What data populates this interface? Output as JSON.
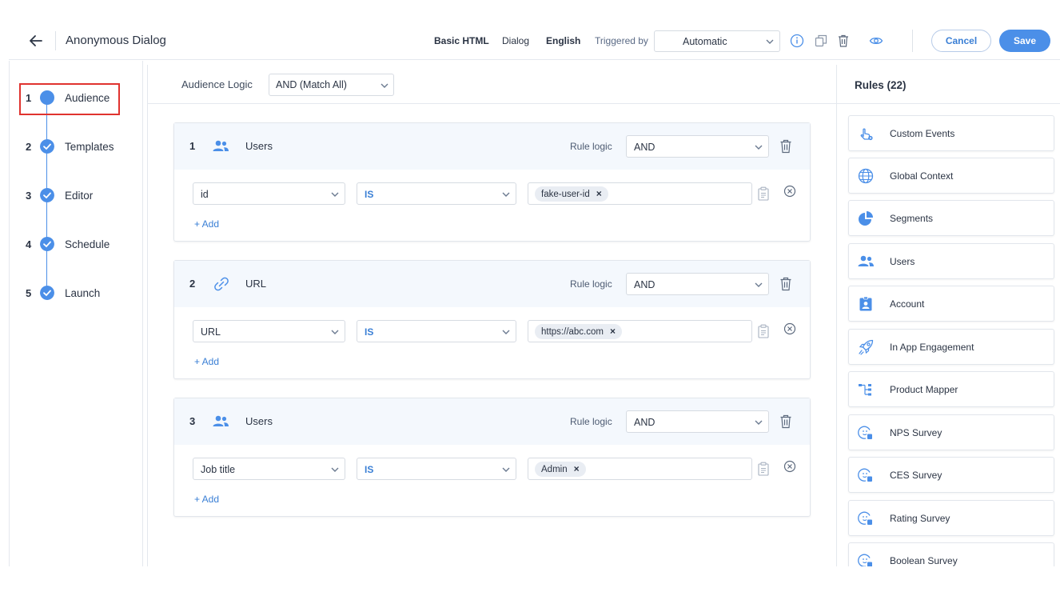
{
  "header": {
    "title": "Anonymous Dialog",
    "template_type": "Basic HTML",
    "dialog_type": "Dialog",
    "language": "English",
    "triggered_by_label": "Triggered by",
    "triggered_by_value": "Automatic",
    "cancel_label": "Cancel",
    "save_label": "Save"
  },
  "stepper": {
    "steps": [
      {
        "num": "1",
        "label": "Audience",
        "state": "active"
      },
      {
        "num": "2",
        "label": "Templates",
        "state": "done"
      },
      {
        "num": "3",
        "label": "Editor",
        "state": "done"
      },
      {
        "num": "4",
        "label": "Schedule",
        "state": "done"
      },
      {
        "num": "5",
        "label": "Launch",
        "state": "done"
      }
    ]
  },
  "main": {
    "audience_logic_label": "Audience Logic",
    "audience_logic_value": "AND (Match All)",
    "rules": [
      {
        "num": "1",
        "type": "Users",
        "icon": "users-icon",
        "rule_logic_label": "Rule logic",
        "rule_logic_value": "AND",
        "attribute": "id",
        "operator": "IS",
        "value_chip": "fake-user-id",
        "add_label": "+ Add"
      },
      {
        "num": "2",
        "type": "URL",
        "icon": "link-icon",
        "rule_logic_label": "Rule logic",
        "rule_logic_value": "AND",
        "attribute": "URL",
        "operator": "IS",
        "value_chip": "https://abc.com",
        "add_label": "+ Add"
      },
      {
        "num": "3",
        "type": "Users",
        "icon": "users-icon",
        "rule_logic_label": "Rule logic",
        "rule_logic_value": "AND",
        "attribute": "Job title",
        "operator": "IS",
        "value_chip": "Admin",
        "add_label": "+ Add"
      }
    ]
  },
  "rules_panel": {
    "title": "Rules (22)",
    "items": [
      {
        "label": "Custom Events",
        "icon": "touch-gear-icon"
      },
      {
        "label": "Global Context",
        "icon": "globe-icon"
      },
      {
        "label": "Segments",
        "icon": "pie-chart-icon"
      },
      {
        "label": "Users",
        "icon": "users-icon"
      },
      {
        "label": "Account",
        "icon": "account-badge-icon"
      },
      {
        "label": "In App Engagement",
        "icon": "rocket-icon"
      },
      {
        "label": "Product Mapper",
        "icon": "tree-icon"
      },
      {
        "label": "NPS Survey",
        "icon": "survey-icon"
      },
      {
        "label": "CES Survey",
        "icon": "survey-icon"
      },
      {
        "label": "Rating Survey",
        "icon": "survey-icon"
      },
      {
        "label": "Boolean Survey",
        "icon": "survey-icon"
      }
    ]
  },
  "colors": {
    "accent": "#4b8fe8",
    "link": "#3a7fd5",
    "highlight": "#e0332f",
    "rule_header_bg": "#f4f8fd"
  }
}
